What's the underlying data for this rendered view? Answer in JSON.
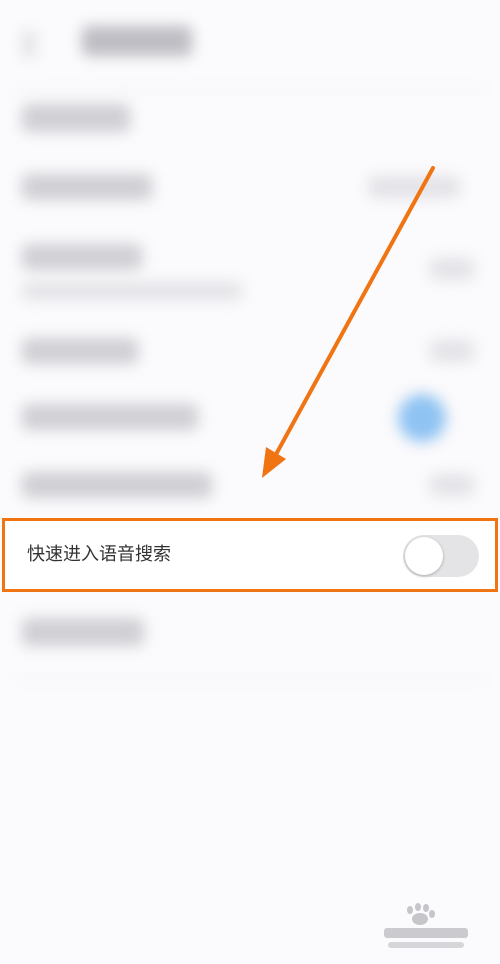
{
  "setting_row": {
    "label": "快速进入语音搜索",
    "toggle_on": false
  },
  "colors": {
    "highlight_border": "#f07412",
    "arrow": "#f07412",
    "toggle_track": "#e4e4e6"
  },
  "icons": {
    "arrow": "arrow-annotation-icon",
    "watermark": "baidu-jingyan-watermark-icon"
  }
}
